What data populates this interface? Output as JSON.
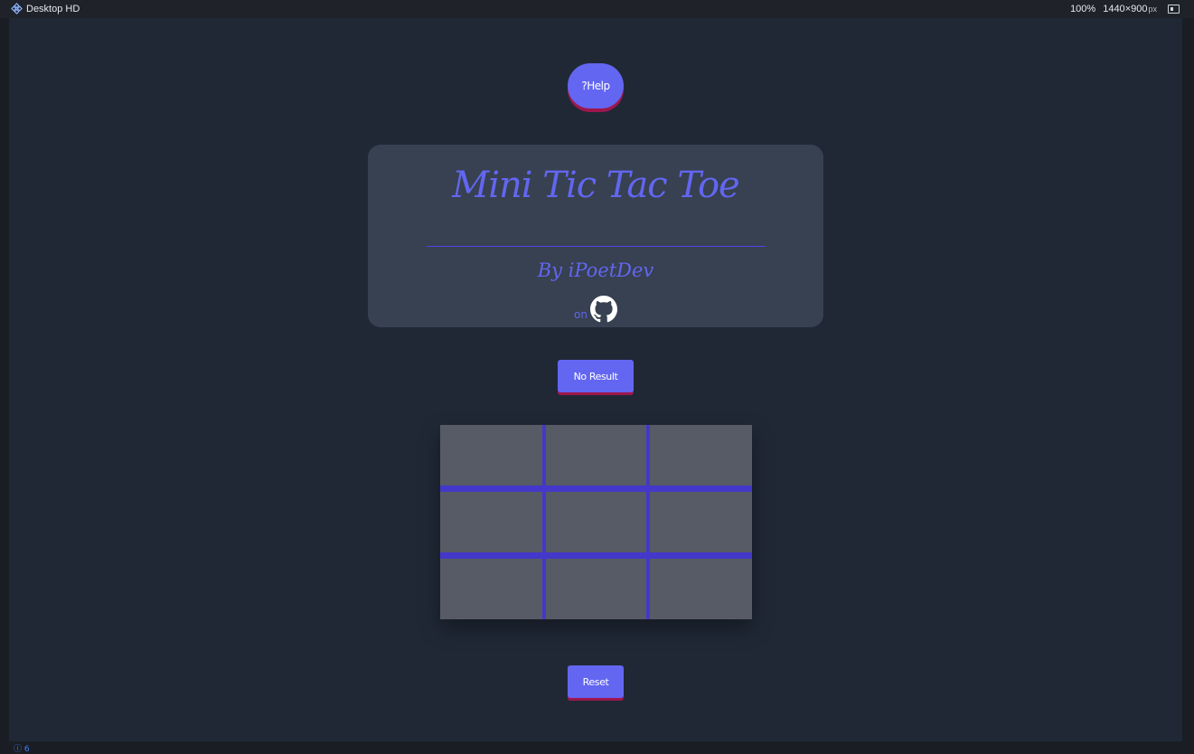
{
  "editor": {
    "frame_name": "Desktop HD",
    "zoom": "100%",
    "width": "1440",
    "times": "×",
    "height": "900",
    "unit": "px",
    "status_indicator": "ⓘ 6"
  },
  "app": {
    "help_label": "?Help",
    "title": "Mini Tic Tac Toe",
    "byline": "By iPoetDev",
    "on_label": "on",
    "result_label": "No Result",
    "reset_label": "Reset",
    "board": {
      "cells": [
        "",
        "",
        "",
        "",
        "",
        "",
        "",
        "",
        ""
      ]
    }
  },
  "colors": {
    "canvas_bg": "#202836",
    "card_bg": "#374151",
    "accent": "#6366f1",
    "accent_shadow": "#9d174d",
    "grid_line": "#4338ca",
    "cell_bg": "#575b65"
  }
}
